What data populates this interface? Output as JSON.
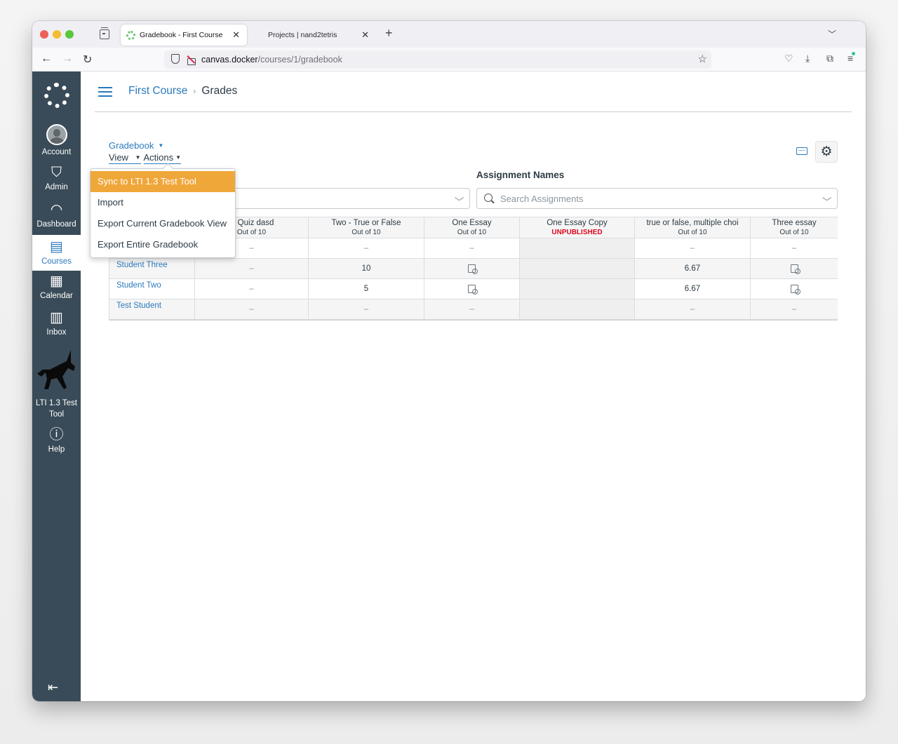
{
  "browser": {
    "tabs": [
      {
        "title": "Gradebook - First Course",
        "active": true
      },
      {
        "title": "Projects | nand2tetris",
        "active": false
      }
    ],
    "url_host": "canvas.docker",
    "url_path": "/courses/1/gradebook"
  },
  "global_nav": {
    "items": [
      {
        "label": "Account",
        "icon": "user-avatar-icon"
      },
      {
        "label": "Admin",
        "icon": "shield-wrench-icon"
      },
      {
        "label": "Dashboard",
        "icon": "speedometer-icon"
      },
      {
        "label": "Courses",
        "icon": "book-icon",
        "active": true
      },
      {
        "label": "Calendar",
        "icon": "calendar-icon"
      },
      {
        "label": "Inbox",
        "icon": "inbox-icon"
      },
      {
        "label": "LTI 1.3 Test Tool",
        "icon": "unicorn-icon"
      },
      {
        "label": "Help",
        "icon": "help-icon"
      }
    ]
  },
  "header": {
    "course": "First Course",
    "separator": "›",
    "page": "Grades"
  },
  "toolbar": {
    "gradebook_label": "Gradebook",
    "view_label": "View",
    "actions_label": "Actions",
    "caret": "▼"
  },
  "actions_menu": {
    "items": [
      {
        "label": "Sync to LTI 1.3 Test Tool",
        "highlighted": true
      },
      {
        "label": "Import"
      },
      {
        "label": "Export Current Gradebook View"
      },
      {
        "label": "Export Entire Gradebook"
      }
    ],
    "highlight_color": "#f0a73a"
  },
  "filters": {
    "assignment_names_label": "Assignment Names",
    "search_placeholder": "Search Assignments"
  },
  "gradebook": {
    "columns": [
      {
        "name": "",
        "sub": ""
      },
      {
        "name": "st Quiz dasd",
        "sub": "Out of 10"
      },
      {
        "name": "Two - True or False",
        "sub": "Out of 10"
      },
      {
        "name": "One Essay",
        "sub": "Out of 10"
      },
      {
        "name": "One Essay Copy",
        "sub": "UNPUBLISHED"
      },
      {
        "name": "true or false, multiple choi",
        "sub": "Out of 10"
      },
      {
        "name": "Three essay",
        "sub": "Out of 10"
      }
    ],
    "rows": [
      {
        "student": "",
        "grades": [
          "–",
          "–",
          "–",
          "",
          "–",
          "–"
        ]
      },
      {
        "student": "Student Three",
        "grades": [
          "–",
          "10",
          "needs-grading",
          "",
          "6.67",
          "needs-grading"
        ]
      },
      {
        "student": "Student Two",
        "grades": [
          "–",
          "5",
          "needs-grading",
          "",
          "6.67",
          "needs-grading"
        ]
      },
      {
        "student": "Test Student",
        "grades": [
          "–",
          "–",
          "–",
          "",
          "–",
          "–"
        ]
      }
    ],
    "unpublished_color": "#e0061f"
  }
}
